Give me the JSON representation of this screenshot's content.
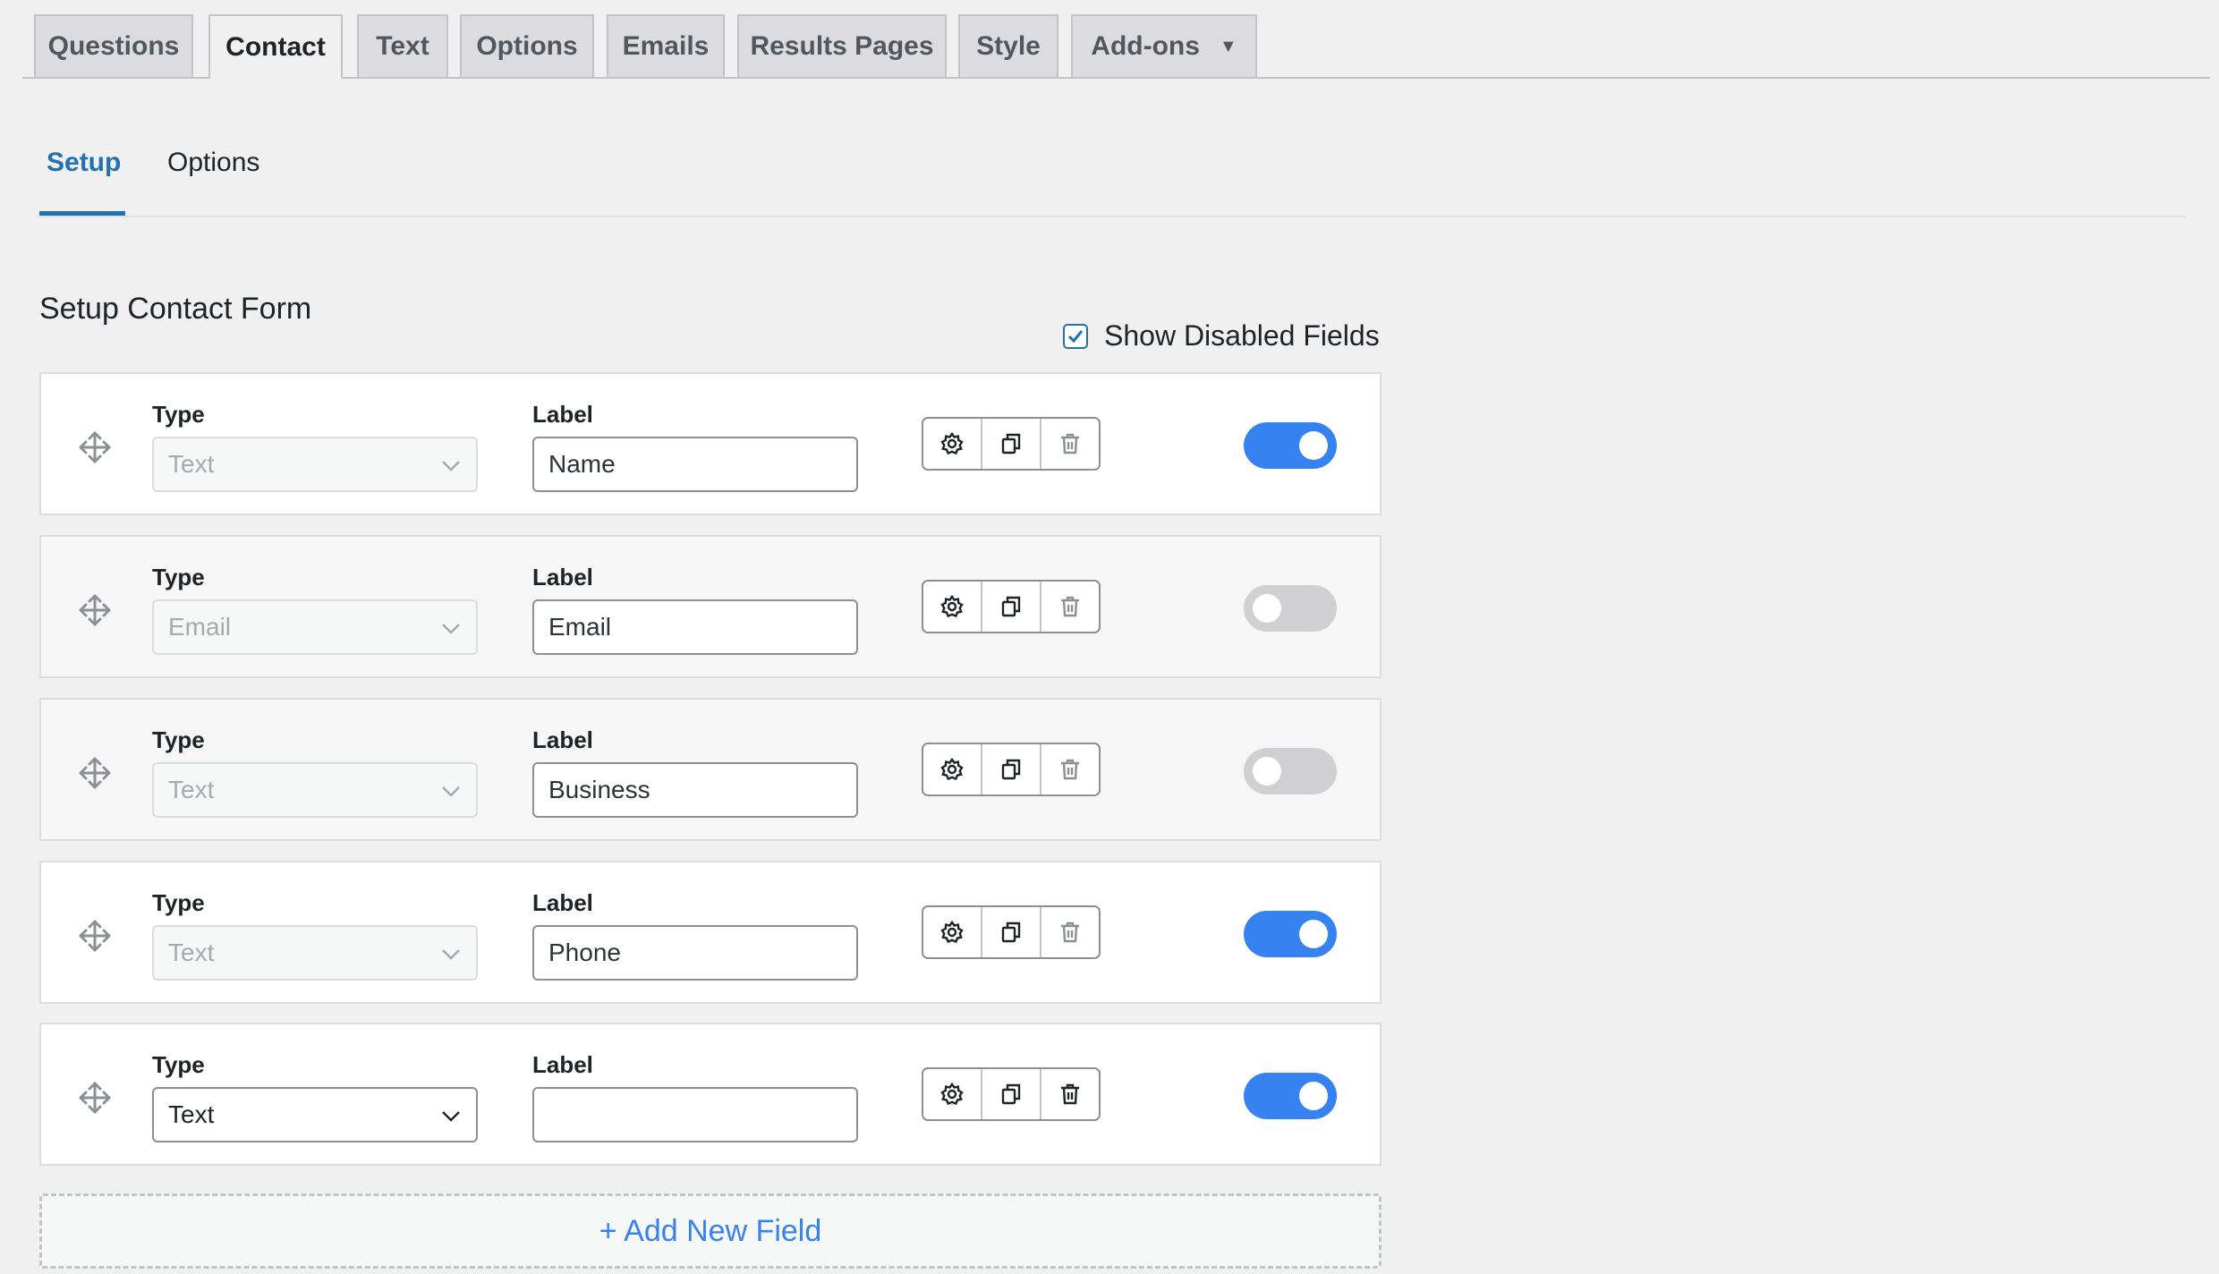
{
  "tabs": [
    {
      "label": "Questions"
    },
    {
      "label": "Contact"
    },
    {
      "label": "Text"
    },
    {
      "label": "Options"
    },
    {
      "label": "Emails"
    },
    {
      "label": "Results Pages"
    },
    {
      "label": "Style"
    },
    {
      "label": "Add-ons",
      "caret": "▼"
    }
  ],
  "active_tab": "Contact",
  "subtabs": [
    {
      "label": "Setup"
    },
    {
      "label": "Options"
    }
  ],
  "active_subtab": "Setup",
  "section_title": "Setup Contact Form",
  "show_disabled": {
    "label": "Show Disabled Fields",
    "checked": true
  },
  "field_labels": {
    "type": "Type",
    "label": "Label"
  },
  "fields": [
    {
      "type": "Text",
      "label": "Name",
      "enabled": true,
      "type_editable": false
    },
    {
      "type": "Email",
      "label": "Email",
      "enabled": false,
      "type_editable": false
    },
    {
      "type": "Text",
      "label": "Business",
      "enabled": false,
      "type_editable": false
    },
    {
      "type": "Text",
      "label": "Phone",
      "enabled": true,
      "type_editable": false
    },
    {
      "type": "Text",
      "label": "",
      "enabled": true,
      "type_editable": true
    }
  ],
  "actions": {
    "settings": "gear-icon",
    "duplicate": "duplicate-icon",
    "delete": "trash-icon"
  },
  "add_field_label": "+ Add New Field",
  "colors": {
    "accent": "#2271b1",
    "toggle_on": "#3582f0",
    "toggle_off": "#d0d0d2"
  }
}
